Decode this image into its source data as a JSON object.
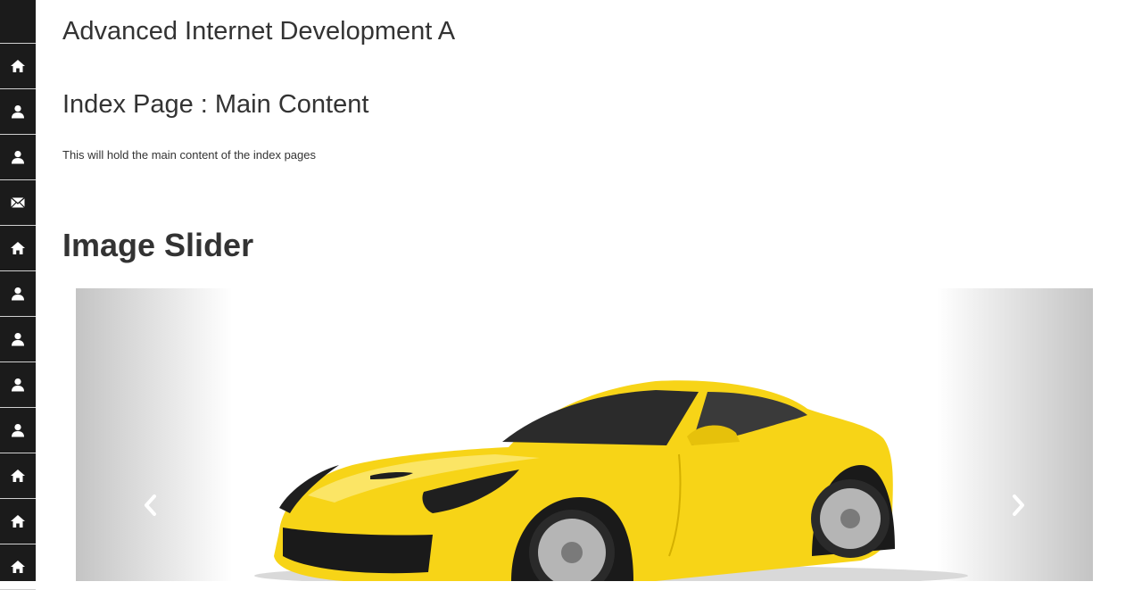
{
  "sidebar": {
    "items": [
      {
        "icon": "home-icon"
      },
      {
        "icon": "user-icon"
      },
      {
        "icon": "user-icon"
      },
      {
        "icon": "envelope-icon"
      },
      {
        "icon": "home-icon"
      },
      {
        "icon": "user-icon"
      },
      {
        "icon": "user-icon"
      },
      {
        "icon": "user-icon"
      },
      {
        "icon": "user-icon"
      },
      {
        "icon": "home-icon"
      },
      {
        "icon": "home-icon"
      },
      {
        "icon": "home-icon"
      }
    ]
  },
  "header": {
    "title": "Advanced Internet Development A"
  },
  "main": {
    "section_title": "Index Page : Main Content",
    "section_text": "This will hold the main content of the index pages",
    "slider_title": "Image Slider"
  },
  "slider": {
    "prev_icon": "chevron-left-icon",
    "next_icon": "chevron-right-icon",
    "car_color": "#f7d417"
  }
}
